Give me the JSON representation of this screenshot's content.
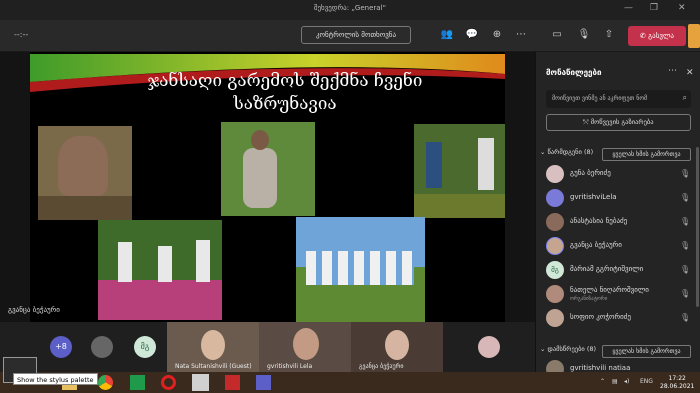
{
  "window": {
    "title": "შეხვედრა: „General“"
  },
  "callbar": {
    "timer": "--:--",
    "control_button": "კონტროლის მოთხოვნა",
    "leave_label": "გასვლა"
  },
  "slide": {
    "title": "ჯანსაღი გარემოს შექმნა ჩვენი საზრუნავია",
    "presenter": "გვანცა ბეჭაური"
  },
  "strip": {
    "overflow_count": "+8",
    "bubble_initials": "მგ",
    "tiles": [
      {
        "name": "Nata Sultanishvili (Guest)"
      },
      {
        "name": "gvritishvili Lela"
      },
      {
        "name": "გვანცა ბეჭაური"
      }
    ]
  },
  "panel": {
    "title": "მონაწილეები",
    "search_placeholder": "მოიწვიეთ ვინმე ან აკრიფეთ ნომ",
    "share_label": "მოწვევის გაზიარება",
    "section_present": {
      "label": "წარმდგენი (8)",
      "mute_all": "ყველას ხმის გამორთვა"
    },
    "section_attendees": {
      "label": "დამსწრეები (8)",
      "mute_all": "ყველას ხმის გამორთვა"
    },
    "participants": [
      {
        "name": "გუნა ბერიძე",
        "sub": ""
      },
      {
        "name": "gvritishviLela",
        "sub": ""
      },
      {
        "name": "ანასტასია ნებაძე",
        "sub": ""
      },
      {
        "name": "გვანცა ბეჭაური",
        "sub": ""
      },
      {
        "name": "მარიამ გგრიტიშვილი",
        "sub": ""
      },
      {
        "name": "ნათელა ნიღაროშვილი",
        "sub": "ორგანიზატორი"
      },
      {
        "name": "სოფიო კოჭორიძე",
        "sub": ""
      }
    ],
    "attendee_partial": "gvritishvili natiaa"
  },
  "taskbar": {
    "time": "17:22",
    "date": "28.06.2021",
    "lang": "ENG"
  },
  "tooltip": "Show the stylus palette",
  "colors": {
    "accent_red": "#c4314b",
    "slide_bg": "#000000",
    "panel_bg": "#242424"
  }
}
